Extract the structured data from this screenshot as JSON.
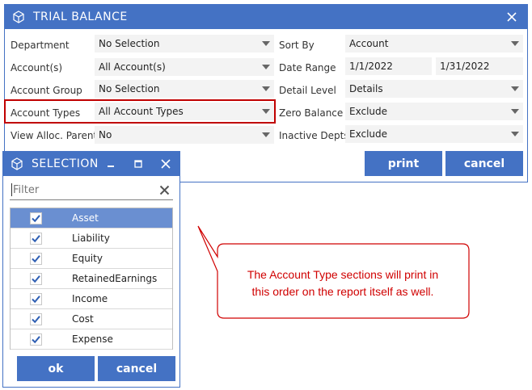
{
  "trial_balance": {
    "title": "TRIAL BALANCE",
    "fields": {
      "department": {
        "label": "Department",
        "value": "No Selection"
      },
      "accounts": {
        "label": "Account(s)",
        "value": "All Account(s)"
      },
      "account_group": {
        "label": "Account Group",
        "value": "No Selection"
      },
      "account_types": {
        "label": "Account Types",
        "value": "All Account Types"
      },
      "view_alloc_parents": {
        "label": "View Alloc. Parents",
        "value": "No"
      },
      "sort_by": {
        "label": "Sort By",
        "value": "Account"
      },
      "date_range": {
        "label": "Date Range",
        "start": "1/1/2022",
        "end": "1/31/2022"
      },
      "detail_level": {
        "label": "Detail Level",
        "value": "Details"
      },
      "zero_balance": {
        "label": "Zero Balance",
        "value": "Exclude"
      },
      "inactive_depts": {
        "label": "Inactive Depts",
        "value": "Exclude"
      }
    },
    "print_label": "print",
    "cancel_label": "cancel"
  },
  "selection": {
    "title": "SELECTION",
    "filter_placeholder": "Filter",
    "items": [
      {
        "label": "Asset",
        "checked": true,
        "selected": true
      },
      {
        "label": "Liability",
        "checked": true,
        "selected": false
      },
      {
        "label": "Equity",
        "checked": true,
        "selected": false
      },
      {
        "label": "RetainedEarnings",
        "checked": true,
        "selected": false
      },
      {
        "label": "Income",
        "checked": true,
        "selected": false
      },
      {
        "label": "Cost",
        "checked": true,
        "selected": false
      },
      {
        "label": "Expense",
        "checked": true,
        "selected": false
      }
    ],
    "ok_label": "ok",
    "cancel_label": "cancel"
  },
  "callout": {
    "line1": "The Account Type sections will print in",
    "line2": "this order on the report itself as well."
  },
  "colors": {
    "titlebar": "#4472c4",
    "selected_row": "#6a8fd1",
    "highlight_border": "#c00000",
    "callout_text": "#d00000"
  },
  "icons": [
    "cube-icon",
    "close-icon",
    "minimize-icon",
    "maximize-icon",
    "dropdown-arrow-icon",
    "checkmark-icon",
    "clear-filter-icon"
  ]
}
